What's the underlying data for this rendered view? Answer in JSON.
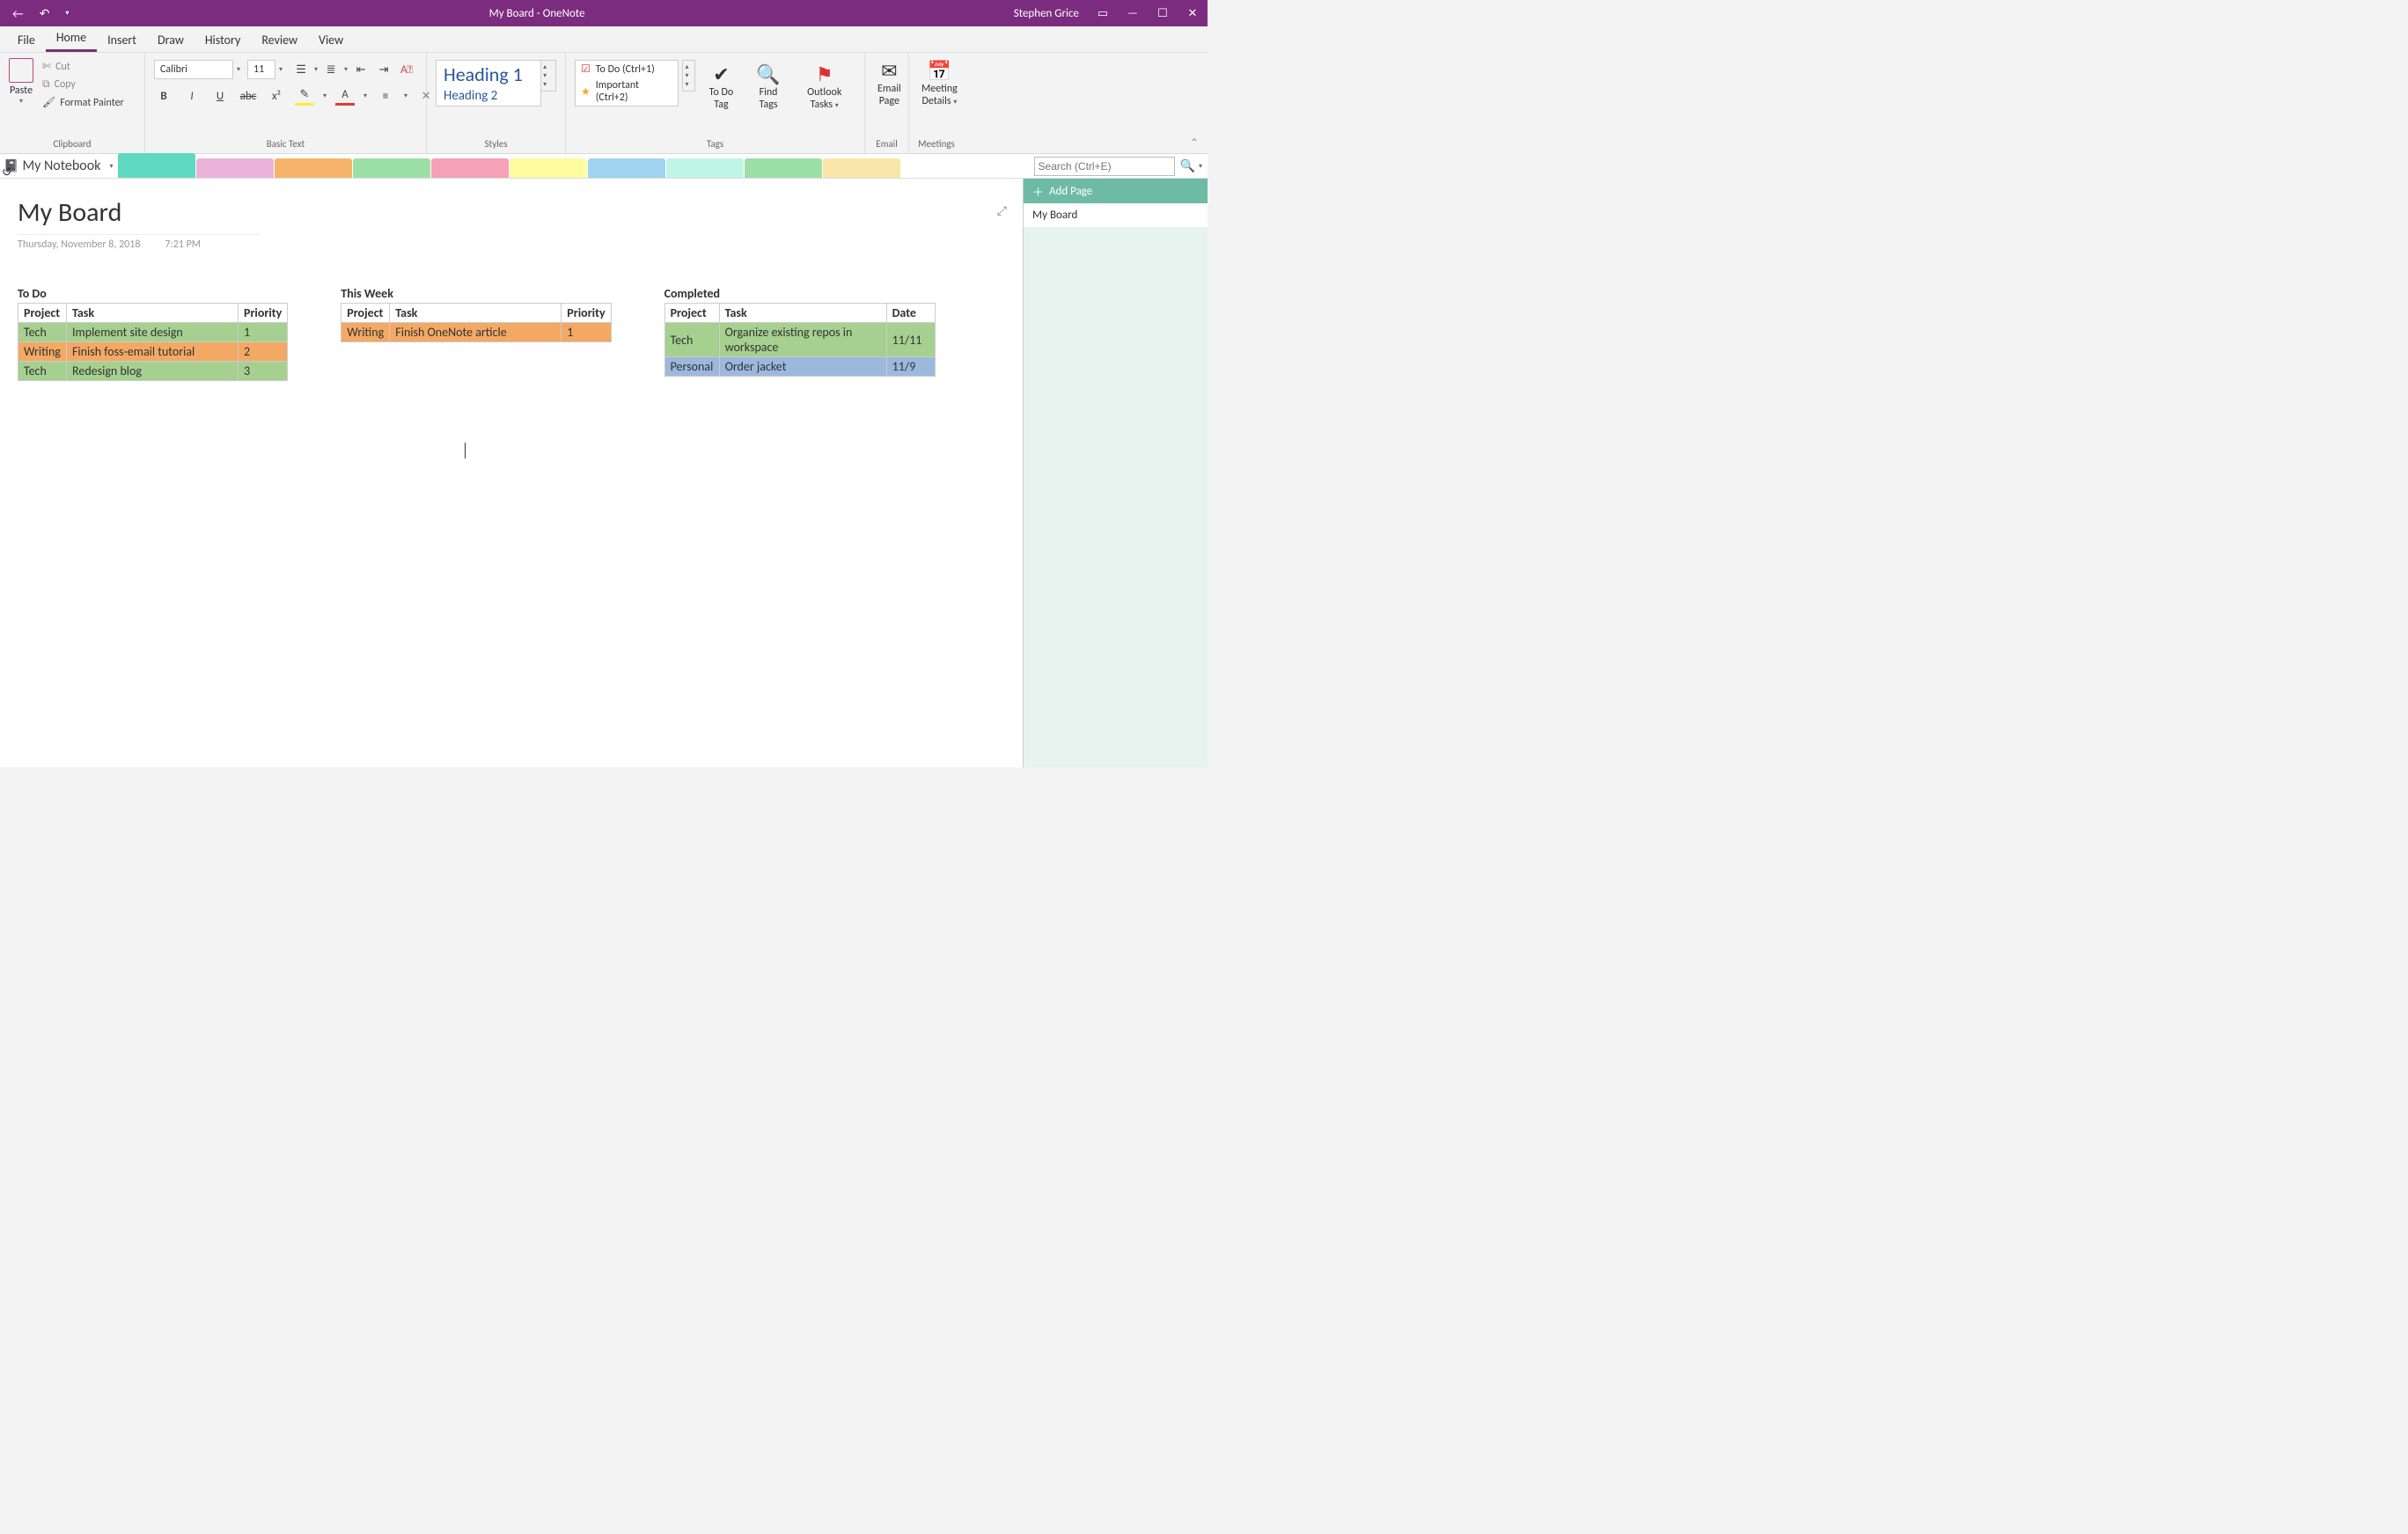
{
  "window": {
    "title": "My Board  -  OneNote",
    "user": "Stephen Grice"
  },
  "menu_tabs": [
    "File",
    "Home",
    "Insert",
    "Draw",
    "History",
    "Review",
    "View"
  ],
  "active_tab": "Home",
  "ribbon": {
    "clipboard": {
      "group": "Clipboard",
      "paste": "Paste",
      "cut": "Cut",
      "copy": "Copy",
      "format_painter": "Format Painter"
    },
    "basic_text": {
      "group": "Basic Text",
      "font": "Calibri",
      "size": "11"
    },
    "styles": {
      "group": "Styles",
      "heading1": "Heading 1",
      "heading2": "Heading 2"
    },
    "tags": {
      "group": "Tags",
      "list": [
        {
          "icon": "☑",
          "label": "To Do (Ctrl+1)"
        },
        {
          "icon": "★",
          "label": "Important (Ctrl+2)"
        }
      ],
      "todo_tag": "To Do Tag",
      "find_tags": "Find Tags",
      "outlook_tasks": "Outlook Tasks"
    },
    "email": {
      "group": "Email",
      "email_page": "Email Page"
    },
    "meetings": {
      "group": "Meetings",
      "meeting_details": "Meeting Details"
    }
  },
  "notebook": {
    "name": "My Notebook"
  },
  "search": {
    "placeholder": "Search (Ctrl+E)"
  },
  "page_pane": {
    "add_page": "Add Page",
    "pages": [
      "My Board"
    ]
  },
  "page": {
    "title": "My Board",
    "date": "Thursday, November 8, 2018",
    "time": "7:21 PM"
  },
  "boards": [
    {
      "name": "To Do",
      "columns": [
        "Project",
        "Task",
        "Priority"
      ],
      "rows": [
        {
          "cells": [
            "Tech",
            "Implement site design",
            "1"
          ],
          "color": "green"
        },
        {
          "cells": [
            "Writing",
            "Finish foss-email tutorial",
            "2"
          ],
          "color": "orange"
        },
        {
          "cells": [
            "Tech",
            "Redesign blog",
            "3"
          ],
          "color": "green"
        }
      ],
      "widths": [
        55,
        195,
        50
      ]
    },
    {
      "name": "This Week",
      "columns": [
        "Project",
        "Task",
        "Priority"
      ],
      "rows": [
        {
          "cells": [
            "Writing",
            "Finish OneNote article",
            "1"
          ],
          "color": "orange"
        }
      ],
      "widths": [
        55,
        195,
        50
      ]
    },
    {
      "name": "Completed",
      "columns": [
        "Project",
        "Task",
        "Date"
      ],
      "rows": [
        {
          "cells": [
            "Tech",
            "Organize existing repos in workspace",
            "11/11"
          ],
          "color": "green"
        },
        {
          "cells": [
            "Personal",
            "Order jacket",
            "11/9"
          ],
          "color": "blue"
        }
      ],
      "widths": [
        62,
        190,
        55
      ]
    }
  ],
  "section_tab_colors": [
    "#5fd9c1",
    "#e9b3d9",
    "#f7b36a",
    "#9de0a6",
    "#f5a1b8",
    "#fffb9f",
    "#9fd3f0",
    "#bff5e6",
    "#9de0a6",
    "#f7e6a7"
  ]
}
